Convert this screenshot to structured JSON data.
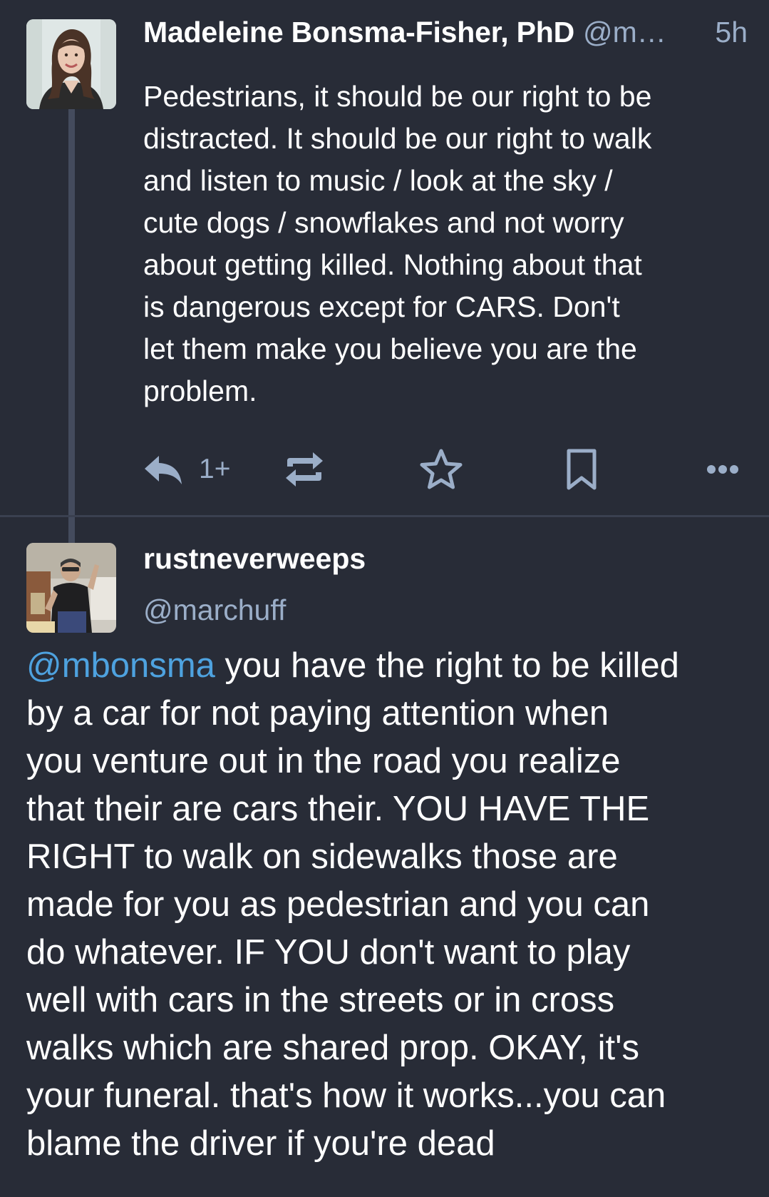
{
  "status_1": {
    "display_name": "Madeleine Bonsma-Fisher, PhD",
    "acct": "@m…",
    "time": "5h",
    "content": "Pedestrians, it should be our right to be\ndistracted. It should be our right to walk\nand listen to music / look at the sky /\ncute dogs / snowflakes and not worry\nabout getting killed. Nothing about that\nis dangerous except for CARS. Don't\nlet them make you believe you are the\nproblem.",
    "actions": {
      "reply_icon": "reply-icon",
      "reply_count": "1+",
      "boost_icon": "boost-icon",
      "favourite_icon": "star-icon",
      "bookmark_icon": "bookmark-icon",
      "more_icon": "more-icon"
    }
  },
  "status_2": {
    "display_name": "rustneverweeps",
    "acct": "@marchuff",
    "mention": "@mbonsma",
    "content": " you have the right to be killed\nby a car for not paying attention when\nyou venture out in the road you realize\nthat their are cars their.   YOU HAVE THE\nRIGHT to walk on sidewalks those are\nmade for you as pedestrian and you can\ndo whatever.   IF YOU don't want to play\nwell with cars in the streets or in cross\nwalks which are shared prop.  OKAY, it's\nyour funeral.  that's how it works...you can\nblame the driver if you're dead"
  },
  "colors": {
    "background": "#282c37",
    "secondary_text": "#9baec8",
    "mention": "#4ea2df",
    "thread_line": "#444b5d"
  }
}
